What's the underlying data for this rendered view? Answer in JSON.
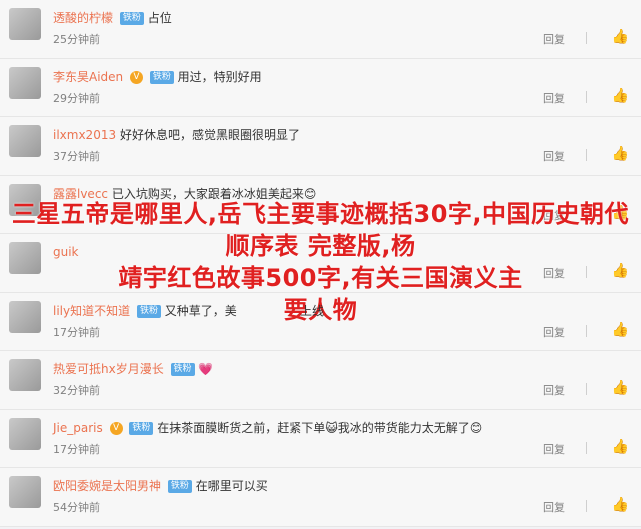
{
  "comments": [
    {
      "user": "透酸的柠檬",
      "verified": false,
      "fan_badge": "铁粉",
      "text": "占位",
      "time": "25分钟前",
      "reply": "回复",
      "like": "👍"
    },
    {
      "user": "李东昊Aiden",
      "verified": true,
      "fan_badge": "铁粉",
      "text": "用过，特别好用",
      "time": "29分钟前",
      "reply": "回复",
      "like": "👍"
    },
    {
      "user": "ilxmx2013",
      "verified": false,
      "fan_badge": "",
      "text": "好好休息吧，感觉黑眼圈很明显了",
      "time": "37分钟前",
      "reply": "回复",
      "like": "👍"
    },
    {
      "user": "露露lvecc",
      "verified": false,
      "fan_badge": "",
      "text": "已入坑购买，大家跟着冰冰姐美起来😊",
      "time": "",
      "reply": "回复",
      "like": "👍"
    },
    {
      "user": "guik",
      "verified": false,
      "fan_badge": "",
      "text": "",
      "time": "",
      "reply": "回复",
      "like": "👍"
    },
    {
      "user": "lily知道不知道",
      "verified": false,
      "fan_badge": "铁粉",
      "text": "又种草了，美",
      "time": "17分钟前",
      "reply": "回复",
      "like": "👍"
    },
    {
      "user": "热爱可抵hx岁月漫长",
      "verified": false,
      "fan_badge": "铁粉",
      "text": "💗",
      "time": "32分钟前",
      "reply": "回复",
      "like": "👍"
    },
    {
      "user": "Jie_paris",
      "verified": true,
      "fan_badge": "铁粉",
      "text": "在抹茶面膜断货之前，赶紧下单😺我冰的带货能力太无解了😊",
      "time": "17分钟前",
      "reply": "回复",
      "like": "👍"
    },
    {
      "user": "欧阳委婉是太阳男神",
      "verified": false,
      "fan_badge": "铁粉",
      "text": "在哪里可以买",
      "time": "54分钟前",
      "reply": "回复",
      "like": "👍"
    }
  ],
  "overlay_lines": [
    "三星五帝是哪里人,岳飞主要事迹概括30字,中国历史朝代顺序表 完整版,杨",
    "靖宇红色故事500字,有关三国演义主",
    "要人物"
  ],
  "overlay_partial": "上线"
}
